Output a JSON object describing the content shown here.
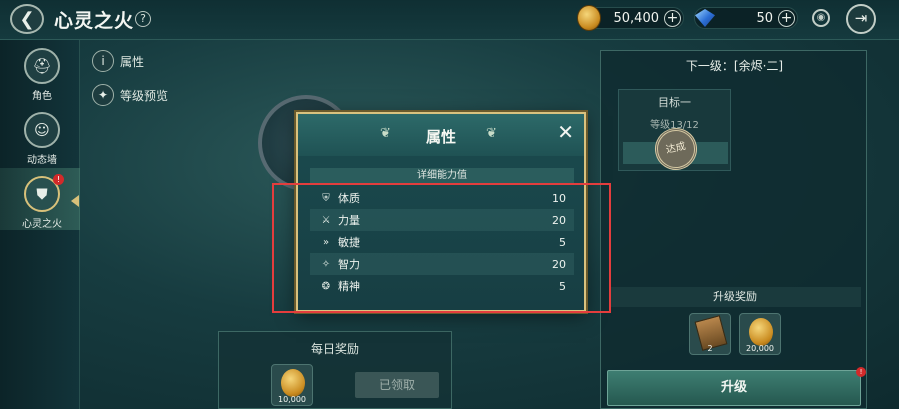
{
  "header": {
    "title": "心灵之火",
    "back_icon": "arrow-left-icon",
    "help_label": "?",
    "gold_value": "50,400",
    "gem_value": "50",
    "plus_label": "+",
    "exit_icon": "exit-icon"
  },
  "sidebar": {
    "items": [
      {
        "label": "角色",
        "icon": "helmet-icon"
      },
      {
        "label": "动态墙",
        "icon": "chat-icon"
      },
      {
        "label": "心灵之火",
        "icon": "flame-shield-icon",
        "badge": "!"
      }
    ]
  },
  "sub_links": {
    "attributes": "属性",
    "attributes_icon": "i",
    "level_preview": "等级预览"
  },
  "right_panel": {
    "next_level_title": "下一级：[余烬·二]",
    "goal_label": "目标一",
    "goal_requirement": "等级13/12",
    "stamp_text": "达成",
    "reward_title": "升级奖励",
    "rewards": [
      {
        "value": "2",
        "icon": "card-icon"
      },
      {
        "value": "20,000",
        "icon": "gold-coin-icon"
      }
    ],
    "upgrade_label": "升级",
    "upgrade_badge": "!"
  },
  "daily": {
    "title": "每日奖励",
    "item_value": "10,000",
    "claimed_label": "已领取"
  },
  "modal": {
    "title": "属性",
    "close_label": "✕",
    "section_title": "详细能力值",
    "stats": [
      {
        "name": "体质",
        "value": "10",
        "icon": "shield-icon"
      },
      {
        "name": "力量",
        "value": "20",
        "icon": "sword-icon"
      },
      {
        "name": "敏捷",
        "value": "5",
        "icon": "boot-icon"
      },
      {
        "name": "智力",
        "value": "20",
        "icon": "sparkle-icon"
      },
      {
        "name": "精神",
        "value": "5",
        "icon": "spirit-icon"
      }
    ]
  },
  "colors": {
    "accent_gold": "#d9c27f",
    "highlight_red": "#e43d3d",
    "panel_teal": "#1b4b4f"
  }
}
